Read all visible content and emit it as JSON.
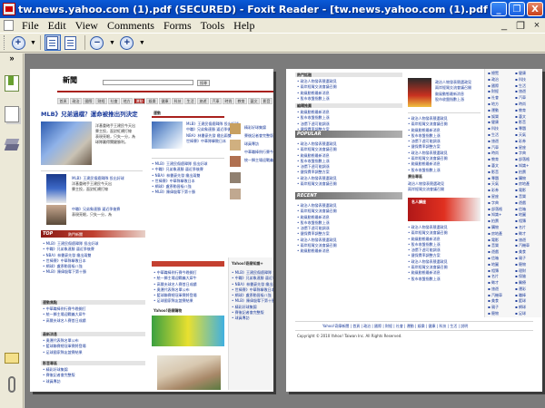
{
  "window": {
    "title": "tw.news.yahoo.com (1).pdf (SECURED) - Foxit Reader - [tw.news.yahoo.com (1).pdf (SECURED)]",
    "minimize_label": "_",
    "maximize_label": "❐",
    "close_label": "X"
  },
  "menu": {
    "items": [
      "File",
      "Edit",
      "View",
      "Comments",
      "Forms",
      "Tools",
      "Help"
    ],
    "mdi_minimize": "_",
    "mdi_restore": "❐",
    "mdi_close": "×"
  },
  "toolbar": {
    "zoom_in": "+",
    "zoom_out": "−",
    "dropdown": "▼"
  },
  "sidepanel": {
    "expand": "»"
  },
  "page1": {
    "logo": "新聞",
    "search_button": "搜尋",
    "nav_tabs": [
      "首頁",
      "政治",
      "國際",
      "財經",
      "社會",
      "地方",
      "運動",
      "娛樂",
      "健康",
      "科技",
      "生活",
      "旅遊",
      "汽車",
      "時尚",
      "教育",
      "藝文",
      "影音"
    ],
    "headline": "MLB》兄弟過檔？運命被推出列決定",
    "summary_lines": [
      "洋基重砲手王建民今天出",
      "賽主投，面對紅襪打線",
      "表現亮眼，只失一分，為",
      "球隊贏得關鍵勝利。"
    ],
    "top_label": "TOP",
    "top_title": "熱門新聞",
    "top_items": [
      "MLB》王建民傷癒歸隊 投出好球",
      "中職》兄弟象連勝 逼近季後賽",
      "NBA》林書豪先發 繳出兩雙",
      "世棒賽》中華隊擊敗日本",
      "網球》盧彥勳晉級八強",
      "MLB》陳偉殷奪下第十勝"
    ],
    "section1_title": "運動焦點",
    "section1_items": [
      "中華職棒例行賽今晚開打",
      "統一獅主場迎戰義大犀牛",
      "高爾夫球名人賽首日成績"
    ],
    "section2_title": "最新消息",
    "section2_items": [
      "奧運代表隊名單公布",
      "籃球聯賽總冠軍賽將登場",
      "足球國家隊友誼賽結果"
    ],
    "section3_title": "影音專區",
    "section3_items": [
      "精彩好球集錦",
      "賽後記者會完整版",
      "球員專訪"
    ],
    "yahoo_shop_label": "Yahoo!奇摩購物",
    "center_tab": "運動",
    "yahoo_box_title": "Yahoo!奇摩知識+"
  },
  "page2": {
    "popular_label": "POPULAR",
    "recent_label": "RECENT",
    "section_titles": [
      "熱門話題",
      "編輯推薦",
      "網友最愛",
      "最新回應"
    ],
    "items": [
      "政治人物發表競選政見",
      "兩岸經貿交流會議召開",
      "颱風動態最新消息",
      "股市收盤指數上漲",
      "油價下週可能調漲",
      "健保費率調整方案"
    ],
    "ad_title": "廣告專區",
    "footer": "Copyright © 2010 Yahoo! Taiwan Inc. All Rights Reserved.",
    "footer_links": "Yahoo!奇摩新聞 | 首頁 | 政治 | 國際 | 財經 | 社會 | 運動 | 娛樂 | 健康 | 科技 | 生活 | 說明",
    "rnav_items": [
      "總覽",
      "政治",
      "國際",
      "財經",
      "社會",
      "地方",
      "運動",
      "娛樂",
      "健康",
      "科技",
      "生活",
      "旅遊",
      "汽車",
      "時尚",
      "教育",
      "藝文",
      "影音",
      "專題",
      "天氣",
      "彩券",
      "星座",
      "字典",
      "部落格",
      "知識+",
      "拍賣",
      "購物",
      "房地產",
      "電影",
      "音樂",
      "遊戲",
      "信箱",
      "地圖",
      "相簿",
      "名片",
      "徵才",
      "旅遊",
      "汽機車",
      "美食",
      "親子",
      "寵物",
      "理財",
      "保險",
      "醫療",
      "運彩",
      "職棒",
      "籃球",
      "網球",
      "足球"
    ],
    "ad_people_label": "名人講座"
  },
  "colors": {
    "yahoo_red": "#a9211d",
    "title_blue": "#0444b8",
    "doc_gray": "#7b7b7b",
    "chrome": "#ece9d8"
  }
}
